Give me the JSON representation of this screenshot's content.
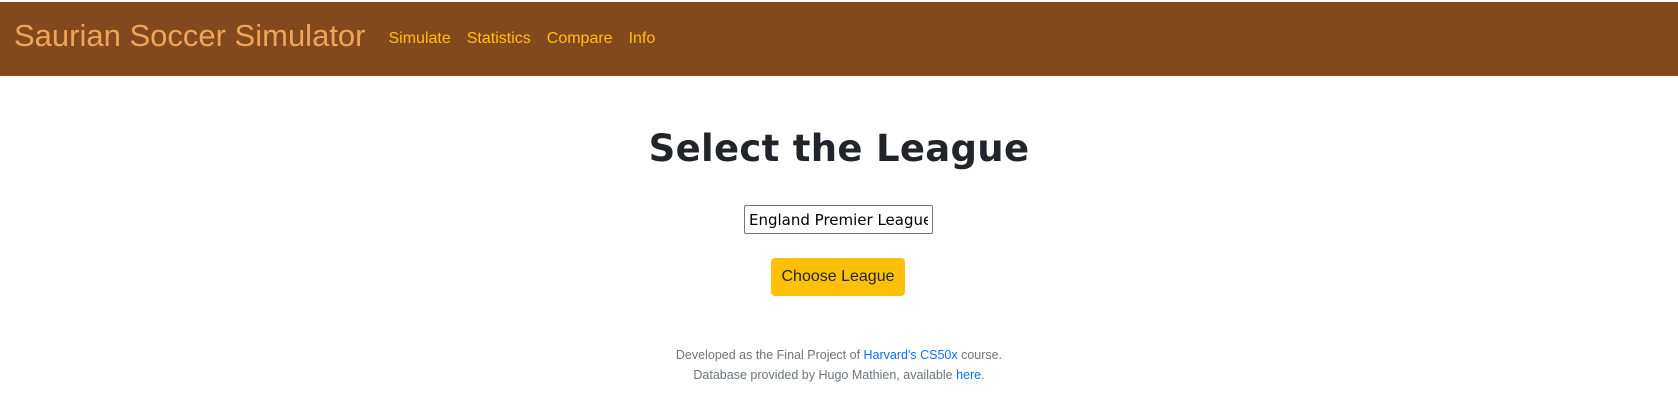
{
  "navbar": {
    "brand": "Saurian Soccer Simulator",
    "links": [
      {
        "label": "Simulate"
      },
      {
        "label": "Statistics"
      },
      {
        "label": "Compare"
      },
      {
        "label": "Info"
      }
    ]
  },
  "main": {
    "title": "Select the League",
    "league_input_value": "England Premier League",
    "choose_button_label": "Choose League"
  },
  "footer": {
    "line1_prefix": "Developed as the Final Project of ",
    "line1_link": "Harvard's CS50x",
    "line1_suffix": " course.",
    "line2_prefix": "Database provided by Hugo Mathien, available ",
    "line2_link": "here",
    "line2_suffix": "."
  },
  "colors": {
    "navbar_bg": "#82491e",
    "brand": "#f0a45a",
    "nav_link": "#ffc107",
    "button_bg": "#ffc107",
    "footer_text": "#6c757d",
    "footer_link": "#0d6efd"
  }
}
